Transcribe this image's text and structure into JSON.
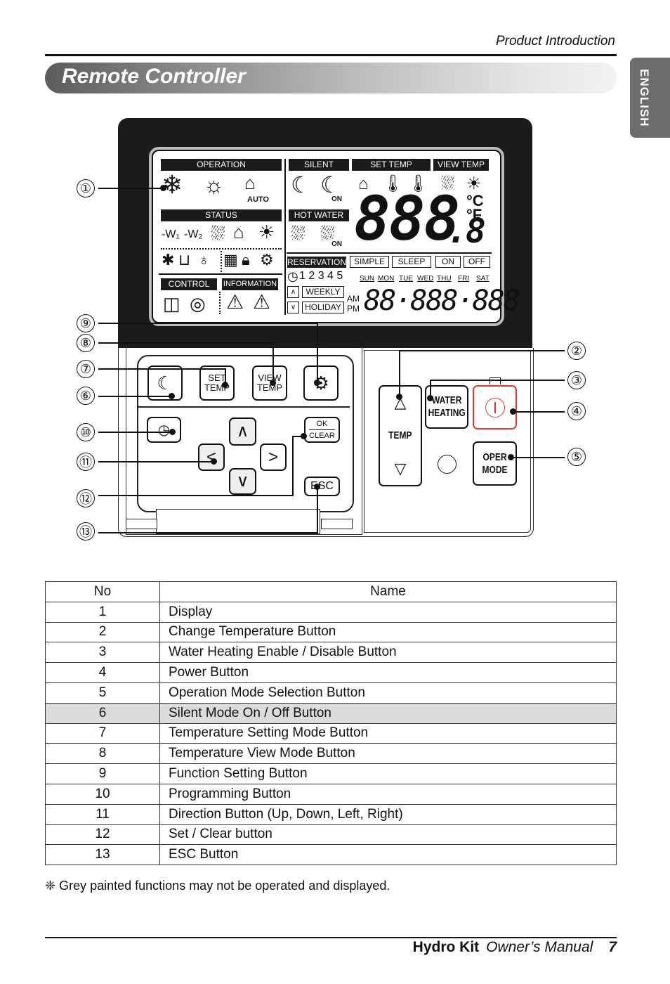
{
  "header": {
    "section": "Product Introduction",
    "title": "Remote Controller",
    "language_tab": "ENGLISH"
  },
  "display": {
    "labels": {
      "operation": "OPERATION",
      "silent": "SILENT",
      "set_temp": "SET TEMP",
      "view_temp": "VIEW TEMP",
      "status": "STATUS",
      "hot_water": "HOT WATER",
      "control": "CONTROL",
      "information": "INFORMATION",
      "reservation": "RESERVATION"
    },
    "auto_label": "AUTO",
    "on_label": "ON",
    "modes": [
      "SIMPLE",
      "SLEEP",
      "ON",
      "OFF"
    ],
    "program_numbers": "1 2 3 4 5",
    "weekly": "WEEKLY",
    "holiday": "HOLIDAY",
    "days": [
      "SUN",
      "MON",
      "TUE",
      "WED",
      "THU",
      "FRI",
      "SAT"
    ],
    "am": "AM",
    "pm": "PM",
    "temp_digits": "888",
    "temp_decimal": ".8",
    "celsius": "°C",
    "fahrenheit": "°F",
    "clock_digits": "88·888·888",
    "icons": [
      "cooling-icon",
      "heating-icon",
      "auto-mode-icon",
      "silent-icon",
      "silent-on-icon",
      "room-temp-icon",
      "water-outlet-temp-icon",
      "water-inlet-temp-icon",
      "hot-water-temp-icon",
      "outdoor-temp-icon",
      "heater1-icon",
      "heater2-icon",
      "hot-water-heater-icon",
      "room-play-icon",
      "sun-play-icon",
      "defrost-icon",
      "drain-icon",
      "water-icon",
      "calendar-icon",
      "lock-icon",
      "no-function-icon",
      "central-control-icon",
      "remote-control-icon",
      "warning-icon",
      "error-icon",
      "shower-icon",
      "shower-on-icon",
      "clock-icon"
    ]
  },
  "buttons": {
    "set_temp": [
      "SET",
      "TEMP"
    ],
    "view_temp": [
      "VIEW",
      "TEMP"
    ],
    "ok": "OK",
    "clear": "CLEAR",
    "esc": "ESC",
    "temp": "TEMP",
    "water_heating": [
      "WATER",
      "HEATING"
    ],
    "oper_mode": [
      "OPER",
      "MODE"
    ]
  },
  "callouts": [
    "①",
    "②",
    "③",
    "④",
    "⑤",
    "⑥",
    "⑦",
    "⑧",
    "⑨",
    "⑩",
    "⑪",
    "⑫",
    "⑬"
  ],
  "table": {
    "headers": [
      "No",
      "Name"
    ],
    "rows": [
      {
        "no": "1",
        "name": "Display"
      },
      {
        "no": "2",
        "name": "Change Temperature Button"
      },
      {
        "no": "3",
        "name": "Water Heating Enable / Disable Button"
      },
      {
        "no": "4",
        "name": "Power Button"
      },
      {
        "no": "5",
        "name": "Operation Mode Selection Button"
      },
      {
        "no": "6",
        "name": "Silent Mode On / Off Button"
      },
      {
        "no": "7",
        "name": "Temperature Setting Mode Button"
      },
      {
        "no": "8",
        "name": "Temperature View Mode Button"
      },
      {
        "no": "9",
        "name": "Function Setting Button"
      },
      {
        "no": "10",
        "name": "Programming Button"
      },
      {
        "no": "11",
        "name": "Direction Button (Up, Down, Left, Right)"
      },
      {
        "no": "12",
        "name": "Set / Clear button"
      },
      {
        "no": "13",
        "name": "ESC Button"
      }
    ],
    "highlight_row": "6"
  },
  "note": "❈ Grey painted functions may not be operated and displayed.",
  "footer": {
    "product": "Hydro Kit",
    "manual": "Owner’s Manual",
    "page": "7"
  },
  "colors": {
    "power_accent": "#e03a2e",
    "remote_body": "#1b1b1b",
    "highlight_row": "#dcdcdc",
    "language_tab": "#6d6d6d"
  }
}
